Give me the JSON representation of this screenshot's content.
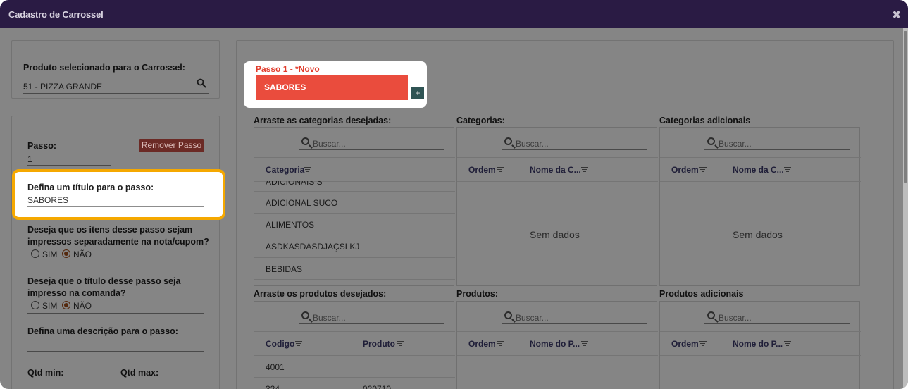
{
  "window": {
    "title": "Cadastro de Carrossel",
    "close_icon": "close-icon"
  },
  "produto": {
    "label": "Produto selecionado para o Carrossel:",
    "value": "51 - PIZZA GRANDE",
    "icon": "search-icon"
  },
  "passo": {
    "label": "Passo:",
    "value": "1",
    "remove_button": "Remover Passo",
    "titulo_label": "Defina um título para o passo:",
    "titulo_value": "SABORES",
    "impressos_label_1": "Deseja que os itens desse passo sejam",
    "impressos_label_2": "impressos separadamente na nota/cupom?",
    "comanda_label_1": "Deseja que o título desse passo seja",
    "comanda_label_2": "impresso na comanda?",
    "sim": "SIM",
    "nao": "NÃO",
    "descricao_label": "Defina uma descrição para o passo:",
    "qtd_min": "Qtd min:",
    "qtd_max": "Qtd max:"
  },
  "passo_card": {
    "heading": "Passo 1 - *Novo",
    "button": "SABORES",
    "add": "+"
  },
  "categorias_section": {
    "drag_title": "Arraste as categorias desejadas:",
    "categorias_title": "Categorias:",
    "adicionais_title": "Categorias adicionais",
    "search_placeholder": "Buscar...",
    "col_categoria": "Categoria",
    "col_ordem": "Ordem",
    "col_nome": "Nome da C...",
    "partial_row": "ADICIONAIS S",
    "rows": [
      "ADICIONAL SUCO",
      "ALIMENTOS",
      "ASDKASDASDJAÇSLKJ",
      "BEBIDAS"
    ],
    "no_data": "Sem dados"
  },
  "produtos_section": {
    "drag_title": "Arraste os produtos desejados:",
    "produtos_title": "Produtos:",
    "adicionais_title": "Produtos adicionais",
    "search_placeholder": "Buscar...",
    "col_codigo": "Codigo",
    "col_produto": "Produto",
    "col_ordem": "Ordem",
    "col_nome": "Nome do P...",
    "rows": [
      {
        "codigo": "4001",
        "produto": ""
      },
      {
        "codigo": "324",
        "produto": "020710"
      }
    ]
  },
  "colors": {
    "titlebar": "#2a1b44",
    "accent_red": "#ea4c3d",
    "highlight": "#f5a800"
  }
}
